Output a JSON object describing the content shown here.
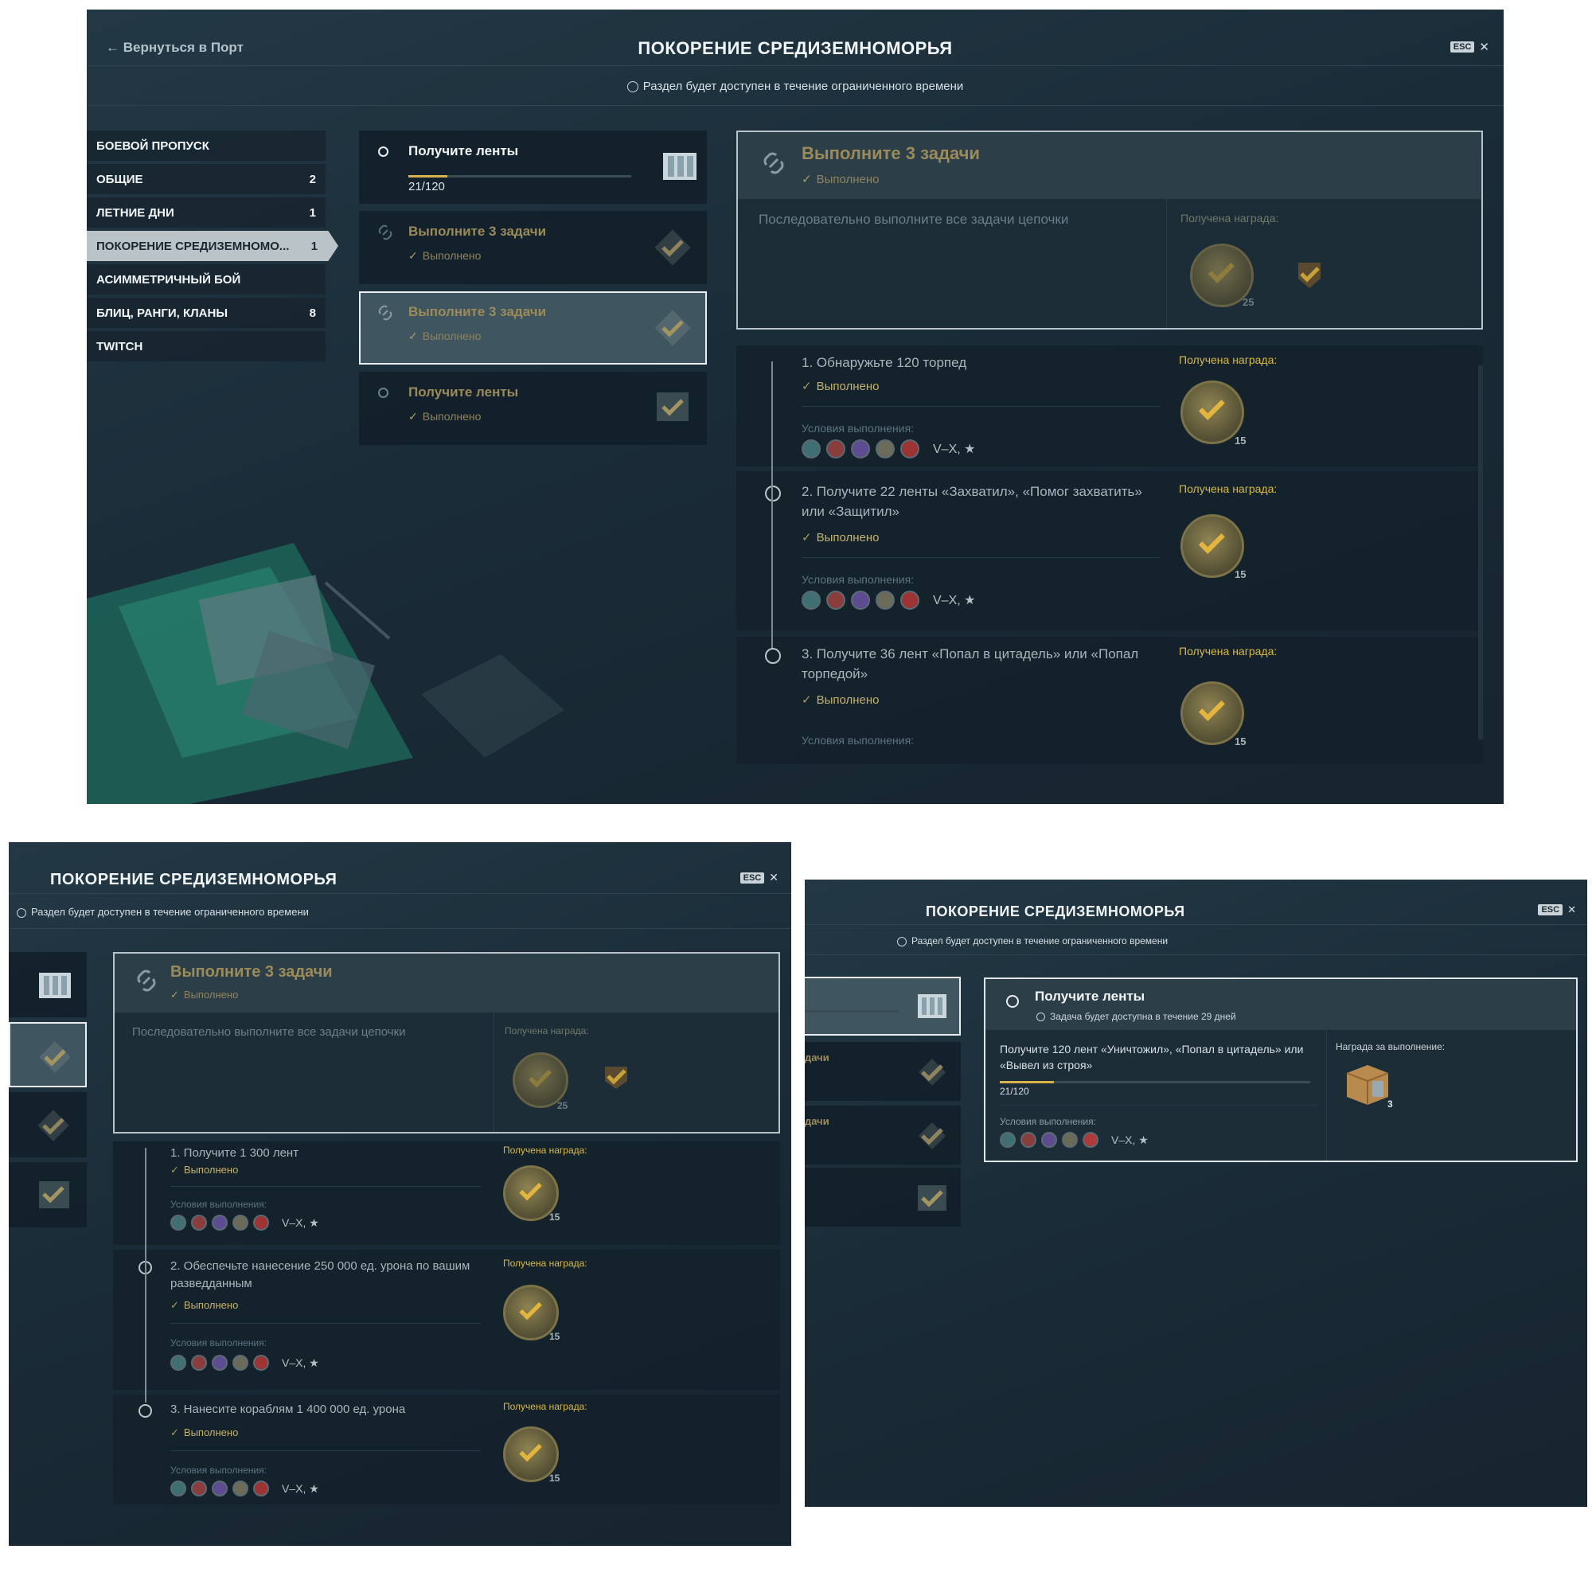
{
  "common": {
    "title": "ПОКОРЕНИЕ СРЕДИЗЕМНОМОРЬЯ",
    "subtitle": "Раздел будет доступен в течение ограниченного времени",
    "esc_label": "ESC",
    "close_glyph": "✕",
    "back_label": "← Вернуться в Порт",
    "done_label": "Выполнено",
    "conditions_label": "Условия выполнения:",
    "reward_received_label": "Получена награда:",
    "tier_label": "V–X, ★",
    "check_glyph": "✓"
  },
  "sidebar": {
    "items": [
      {
        "label": "БОЕВОЙ ПРОПУСК",
        "count": ""
      },
      {
        "label": "ОБЩИЕ",
        "count": "2"
      },
      {
        "label": "ЛЕТНИЕ ДНИ",
        "count": "1"
      },
      {
        "label": "ПОКОРЕНИЕ СРЕДИЗЕМНОМО...",
        "count": "1",
        "active": true
      },
      {
        "label": "АСИММЕТРИЧНЫЙ БОЙ",
        "count": ""
      },
      {
        "label": "БЛИЦ, РАНГИ, КЛАНЫ",
        "count": "8"
      },
      {
        "label": "TWITCH",
        "count": ""
      }
    ]
  },
  "missions": [
    {
      "title": "Получите ленты",
      "progress_text": "21/120",
      "progress": 0.175
    },
    {
      "title": "Выполните 3 задачи",
      "status": "Выполнено"
    },
    {
      "title": "Выполните 3 задачи",
      "status": "Выполнено",
      "selected": true
    },
    {
      "title": "Получите ленты",
      "status": "Выполнено"
    }
  ],
  "detail1": {
    "title": "Выполните 3 задачи",
    "status": "Выполнено",
    "description": "Последовательно выполните все задачи цепочки",
    "reward_label": "Получена награда:",
    "reward_count": "25",
    "tasks": [
      {
        "text": "1. Обнаружьте 120 торпед",
        "reward_count": "15"
      },
      {
        "text": "2. Получите 22 ленты «Захватил», «Помог захватить» или «Защитил»",
        "reward_count": "15"
      },
      {
        "text": "3. Получите 36 лент «Попал в цитадель» или «Попал торпедой»",
        "reward_count": "15"
      }
    ]
  },
  "detail2": {
    "title": "Выполните 3 задачи",
    "status": "Выполнено",
    "description": "Последовательно выполните все задачи цепочки",
    "reward_label": "Получена награда:",
    "reward_count": "25",
    "tasks": [
      {
        "text": "1. Получите 1 300 лент",
        "reward_count": "15"
      },
      {
        "text": "2. Обеспечьте нанесение 250 000 ед. урона по вашим разведданным",
        "reward_count": "15"
      },
      {
        "text": "3. Нанесите кораблям 1 400 000 ед. урона",
        "reward_count": "15"
      }
    ]
  },
  "panel3": {
    "mission_fragment_1": "дачи",
    "mission_fragment_2": "дачи",
    "title": "Получите ленты",
    "timer": "Задача будет доступна в течение 29 дней",
    "description": "Получите 120 лент «Уничтожил», «Попал в цитадель» или «Вывел из строя»",
    "progress_text": "21/120",
    "progress": 0.175,
    "reward_label": "Награда за выполнение:",
    "reward_count": "3"
  },
  "colors": {
    "accent_gold": "#d7b84c",
    "done_text": "#8f845d",
    "panel_bg": "#1a2c38",
    "selected_border": "#e8eef1"
  }
}
